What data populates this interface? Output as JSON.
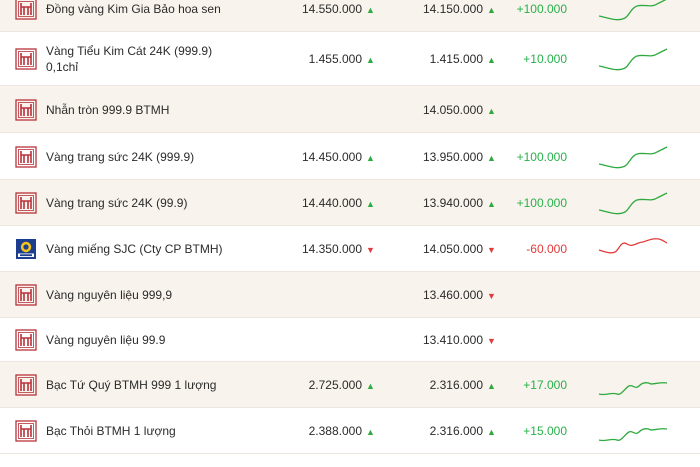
{
  "colors": {
    "up": "#2eaa3f",
    "down": "#e23b3b",
    "brand": "#b8323a",
    "row_alt": "#f8f3ec"
  },
  "rows": [
    {
      "name_line1": "Đồng vàng Kim Gia Bảo hoa sen",
      "name_line2": "",
      "buy": "14.550.000",
      "buy_dir": "up",
      "sell": "14.150.000",
      "sell_dir": "up",
      "change": "+100.000",
      "change_dir": "up",
      "logo": "btmh-logo-icon",
      "spark": "up"
    },
    {
      "name_line1": "Vàng Tiểu Kim Cát 24K (999.9)",
      "name_line2": "0,1chỉ",
      "buy": "1.455.000",
      "buy_dir": "up",
      "sell": "1.415.000",
      "sell_dir": "up",
      "change": "+10.000",
      "change_dir": "up",
      "logo": "btmh-logo-icon",
      "spark": "up"
    },
    {
      "name_line1": "Nhẫn tròn 999.9 BTMH",
      "name_line2": "",
      "buy": "",
      "buy_dir": "",
      "sell": "14.050.000",
      "sell_dir": "up",
      "change": "",
      "change_dir": "",
      "logo": "btmh-logo-icon",
      "spark": ""
    },
    {
      "name_line1": "Vàng trang sức 24K (999.9)",
      "name_line2": "",
      "buy": "14.450.000",
      "buy_dir": "up",
      "sell": "13.950.000",
      "sell_dir": "up",
      "change": "+100.000",
      "change_dir": "up",
      "logo": "btmh-logo-icon",
      "spark": "up"
    },
    {
      "name_line1": "Vàng trang sức 24K (99.9)",
      "name_line2": "",
      "buy": "14.440.000",
      "buy_dir": "up",
      "sell": "13.940.000",
      "sell_dir": "up",
      "change": "+100.000",
      "change_dir": "up",
      "logo": "btmh-logo-icon",
      "spark": "up"
    },
    {
      "name_line1": "Vàng miếng SJC (Cty CP BTMH)",
      "name_line2": "",
      "buy": "14.350.000",
      "buy_dir": "down",
      "sell": "14.050.000",
      "sell_dir": "down",
      "change": "-60.000",
      "change_dir": "down",
      "logo": "sjc-logo-icon",
      "spark": "down"
    },
    {
      "name_line1": "Vàng nguyên liệu 999,9",
      "name_line2": "",
      "buy": "",
      "buy_dir": "",
      "sell": "13.460.000",
      "sell_dir": "down",
      "change": "",
      "change_dir": "",
      "logo": "btmh-logo-icon",
      "spark": ""
    },
    {
      "name_line1": "Vàng nguyên liệu 99.9",
      "name_line2": "",
      "buy": "",
      "buy_dir": "",
      "sell": "13.410.000",
      "sell_dir": "down",
      "change": "",
      "change_dir": "",
      "logo": "btmh-logo-icon",
      "spark": ""
    },
    {
      "name_line1": "Bạc Tứ Quý BTMH 999 1 lượng",
      "name_line2": "",
      "buy": "2.725.000",
      "buy_dir": "up",
      "sell": "2.316.000",
      "sell_dir": "up",
      "change": "+17.000",
      "change_dir": "up",
      "logo": "btmh-logo-icon",
      "spark": "wave-up"
    },
    {
      "name_line1": "Bạc Thỏi BTMH 1 lượng",
      "name_line2": "",
      "buy": "2.388.000",
      "buy_dir": "up",
      "sell": "2.316.000",
      "sell_dir": "up",
      "change": "+15.000",
      "change_dir": "up",
      "logo": "btmh-logo-icon",
      "spark": "wave-up"
    }
  ]
}
